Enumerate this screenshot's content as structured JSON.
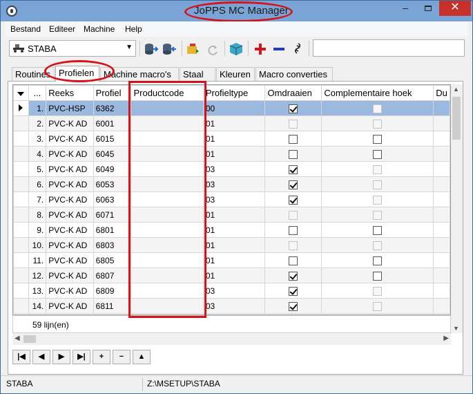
{
  "window": {
    "title": "JoPPS MC Manager",
    "minimize": "–",
    "close": "✕"
  },
  "menu": [
    "Bestand",
    "Editeer",
    "Machine",
    "Help"
  ],
  "toolbar": {
    "combo_value": "STABA"
  },
  "tabs": [
    "Routines",
    "Profielen",
    "Machine macro's",
    "Staal",
    "Kleuren",
    "Macro converties"
  ],
  "grid": {
    "columns": [
      "...",
      "Reeks",
      "Profiel",
      "Productcode",
      "Profieltype",
      "Omdraaien",
      "Complementaire hoek",
      "Du"
    ],
    "rows": [
      {
        "n": "1.",
        "reeks": "PVC-HSP",
        "profiel": "6362",
        "code": "",
        "type": "00",
        "omdraaien": true,
        "omdraaien_enabled": true,
        "comp": false,
        "comp_enabled": false
      },
      {
        "n": "2.",
        "reeks": "PVC-K AD",
        "profiel": "6001",
        "code": "",
        "type": "01",
        "omdraaien": false,
        "omdraaien_enabled": false,
        "comp": false,
        "comp_enabled": false
      },
      {
        "n": "3.",
        "reeks": "PVC-K AD",
        "profiel": "6015",
        "code": "",
        "type": "01",
        "omdraaien": false,
        "omdraaien_enabled": true,
        "comp": false,
        "comp_enabled": true
      },
      {
        "n": "4.",
        "reeks": "PVC-K AD",
        "profiel": "6045",
        "code": "",
        "type": "01",
        "omdraaien": false,
        "omdraaien_enabled": true,
        "comp": false,
        "comp_enabled": true
      },
      {
        "n": "5.",
        "reeks": "PVC-K AD",
        "profiel": "6049",
        "code": "",
        "type": "03",
        "omdraaien": true,
        "omdraaien_enabled": true,
        "comp": false,
        "comp_enabled": false
      },
      {
        "n": "6.",
        "reeks": "PVC-K AD",
        "profiel": "6053",
        "code": "",
        "type": "03",
        "omdraaien": true,
        "omdraaien_enabled": true,
        "comp": false,
        "comp_enabled": false
      },
      {
        "n": "7.",
        "reeks": "PVC-K AD",
        "profiel": "6063",
        "code": "",
        "type": "03",
        "omdraaien": true,
        "omdraaien_enabled": true,
        "comp": false,
        "comp_enabled": false
      },
      {
        "n": "8.",
        "reeks": "PVC-K AD",
        "profiel": "6071",
        "code": "",
        "type": "01",
        "omdraaien": false,
        "omdraaien_enabled": false,
        "comp": false,
        "comp_enabled": false
      },
      {
        "n": "9.",
        "reeks": "PVC-K AD",
        "profiel": "6801",
        "code": "",
        "type": "01",
        "omdraaien": false,
        "omdraaien_enabled": true,
        "comp": false,
        "comp_enabled": true
      },
      {
        "n": "10.",
        "reeks": "PVC-K AD",
        "profiel": "6803",
        "code": "",
        "type": "01",
        "omdraaien": false,
        "omdraaien_enabled": false,
        "comp": false,
        "comp_enabled": false
      },
      {
        "n": "11.",
        "reeks": "PVC-K AD",
        "profiel": "6805",
        "code": "",
        "type": "01",
        "omdraaien": false,
        "omdraaien_enabled": true,
        "comp": false,
        "comp_enabled": true
      },
      {
        "n": "12.",
        "reeks": "PVC-K AD",
        "profiel": "6807",
        "code": "",
        "type": "01",
        "omdraaien": true,
        "omdraaien_enabled": true,
        "comp": false,
        "comp_enabled": true
      },
      {
        "n": "13.",
        "reeks": "PVC-K AD",
        "profiel": "6809",
        "code": "",
        "type": "03",
        "omdraaien": true,
        "omdraaien_enabled": true,
        "comp": false,
        "comp_enabled": false
      },
      {
        "n": "14.",
        "reeks": "PVC-K AD",
        "profiel": "6811",
        "code": "",
        "type": "03",
        "omdraaien": true,
        "omdraaien_enabled": true,
        "comp": false,
        "comp_enabled": false
      }
    ],
    "count_label": "59 lijn(en)"
  },
  "navigator": [
    "|◀",
    "◀",
    "▶",
    "▶|",
    "+",
    "−",
    "▲"
  ],
  "status": {
    "left": "STABA",
    "path": "Z:\\MSETUP\\STABA"
  }
}
